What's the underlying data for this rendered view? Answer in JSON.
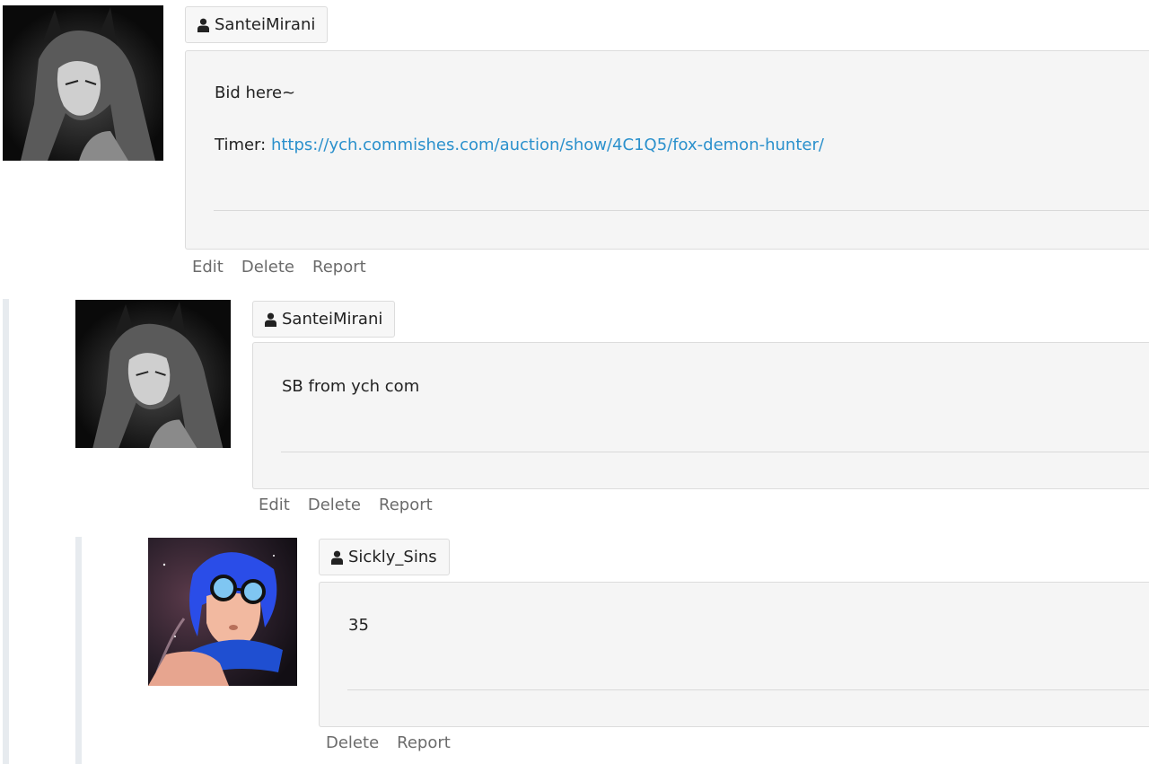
{
  "comments": [
    {
      "username": "SanteiMirani",
      "body_line1": "Bid here~",
      "timer_label": "Timer:",
      "timer_link": "https://ych.commishes.com/auction/show/4C1Q5/fox-demon-hunter/",
      "actions": [
        "Edit",
        "Delete",
        "Report"
      ],
      "avatar_icon": "fox-eared-character-avatar"
    },
    {
      "username": "SanteiMirani",
      "body_line1": "SB from ych com",
      "actions": [
        "Edit",
        "Delete",
        "Report"
      ],
      "avatar_icon": "fox-eared-character-avatar"
    },
    {
      "username": "Sickly_Sins",
      "body_line1": "35",
      "actions": [
        "Delete",
        "Report"
      ],
      "avatar_icon": "blue-haired-goggles-character-avatar"
    }
  ],
  "icons": {
    "user": "user-icon"
  },
  "colors": {
    "link": "#2a90cc",
    "action_text": "#6b6b6b",
    "box_bg": "#f5f5f5",
    "rail": "#e7ebef"
  }
}
